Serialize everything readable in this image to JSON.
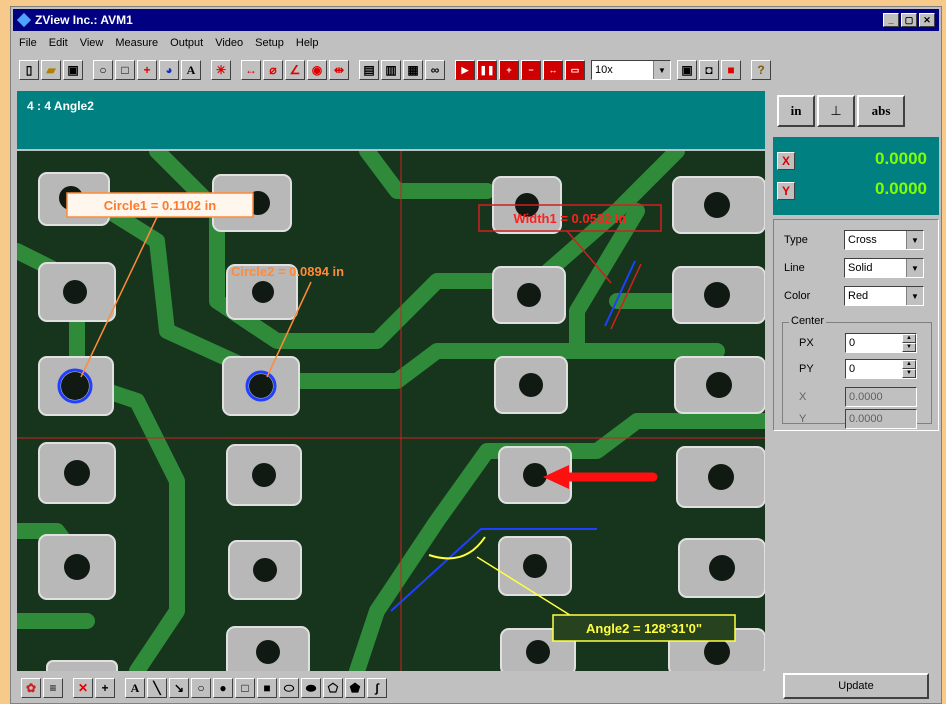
{
  "window": {
    "title": "ZView Inc.: AVM1",
    "controls": [
      "_",
      "▢",
      "✕"
    ]
  },
  "menu": [
    "File",
    "Edit",
    "View",
    "Measure",
    "Output",
    "Video",
    "Setup",
    "Help"
  ],
  "toolbar": {
    "zoom": "10x",
    "help_label": "?"
  },
  "info": {
    "label": "4 : 4  Angle2"
  },
  "annotations": {
    "circle1": "Circle1 = 0.1102 in",
    "circle2": "Circle2 = 0.0894 in",
    "width1": "Width1 = 0.0532 in",
    "angle2": "Angle2 = 128°31'0\""
  },
  "units": {
    "in": "in",
    "abs": "abs"
  },
  "coords": {
    "x_label": "X",
    "y_label": "Y",
    "x_value": "0.0000",
    "y_value": "0.0000"
  },
  "props": {
    "type_label": "Type",
    "type_value": "Cross",
    "line_label": "Line",
    "line_value": "Solid",
    "color_label": "Color",
    "color_value": "Red",
    "center_label": "Center",
    "px_label": "PX",
    "px_value": "0",
    "py_label": "PY",
    "py_value": "0",
    "x_label": "X",
    "x_value": "0.0000",
    "y_label": "Y",
    "y_value": "0.0000"
  },
  "update_label": "Update",
  "colors": {
    "titlebar": "#000080",
    "teal": "#008080",
    "coord_text": "#7fff00",
    "accent_red": "#e00000"
  }
}
